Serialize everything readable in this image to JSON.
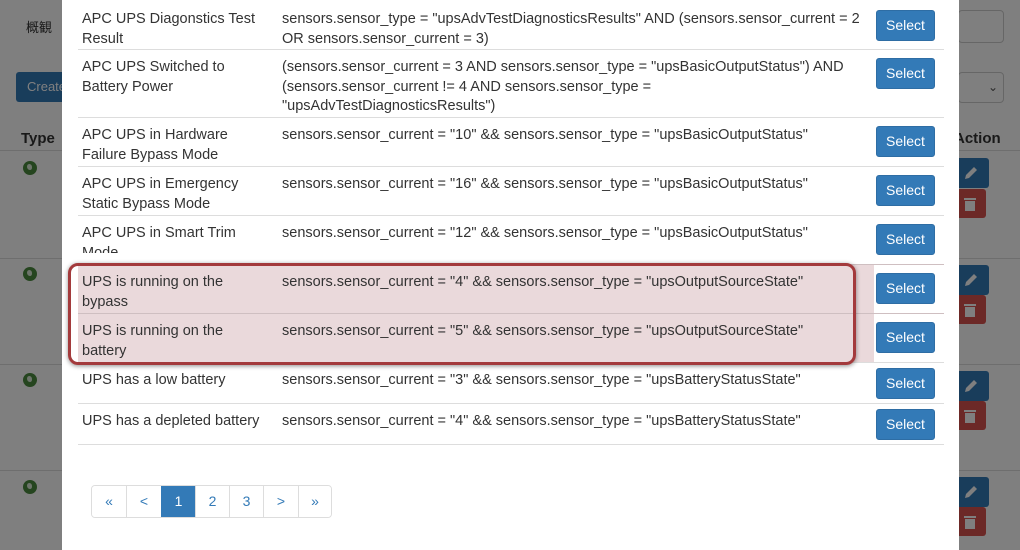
{
  "background": {
    "tab_label": "概観",
    "create_button": "Create",
    "type_header": "Type",
    "action_header": "Action"
  },
  "rules": [
    {
      "name": "APC UPS Diagonstics Test Result",
      "condition": "sensors.sensor_type = \"upsAdvTestDiagnosticsResults\" AND (sensors.sensor_current = 2 OR sensors.sensor_current = 3)",
      "action": "Select"
    },
    {
      "name": "APC UPS Switched to Battery Power",
      "condition": "(sensors.sensor_current = 3 AND sensors.sensor_type = \"upsBasicOutputStatus\") AND (sensors.sensor_current != 4 AND sensors.sensor_type = \"upsAdvTestDiagnosticsResults\")",
      "action": "Select"
    },
    {
      "name": "APC UPS in Hardware Failure Bypass Mode",
      "condition": "sensors.sensor_current = \"10\" && sensors.sensor_type = \"upsBasicOutputStatus\"",
      "action": "Select"
    },
    {
      "name": "APC UPS in Emergency Static Bypass Mode",
      "condition": "sensors.sensor_current = \"16\" && sensors.sensor_type = \"upsBasicOutputStatus\"",
      "action": "Select"
    },
    {
      "name": "APC UPS in Smart Trim Mode",
      "condition": "sensors.sensor_current = \"12\" && sensors.sensor_type = \"upsBasicOutputStatus\"",
      "action": "Select"
    },
    {
      "name": "UPS is running on the bypass",
      "condition": "sensors.sensor_current = \"4\" && sensors.sensor_type = \"upsOutputSourceState\"",
      "action": "Select"
    },
    {
      "name": "UPS is running on the battery",
      "condition": "sensors.sensor_current = \"5\" && sensors.sensor_type = \"upsOutputSourceState\"",
      "action": "Select"
    },
    {
      "name": "UPS has a low battery",
      "condition": "sensors.sensor_current = \"3\" && sensors.sensor_type = \"upsBatteryStatusState\"",
      "action": "Select"
    },
    {
      "name": "UPS has a depleted battery",
      "condition": "sensors.sensor_current = \"4\" && sensors.sensor_type = \"upsBatteryStatusState\"",
      "action": "Select"
    }
  ],
  "pagination": {
    "first": "«",
    "prev": "<",
    "pages": [
      "1",
      "2",
      "3"
    ],
    "active_page": "1",
    "next": ">",
    "last": "»"
  },
  "colors": {
    "primary": "#337ab7",
    "danger": "#d9534f",
    "highlight_border": "#a33a3c",
    "highlight_fill": "#ead9db"
  }
}
